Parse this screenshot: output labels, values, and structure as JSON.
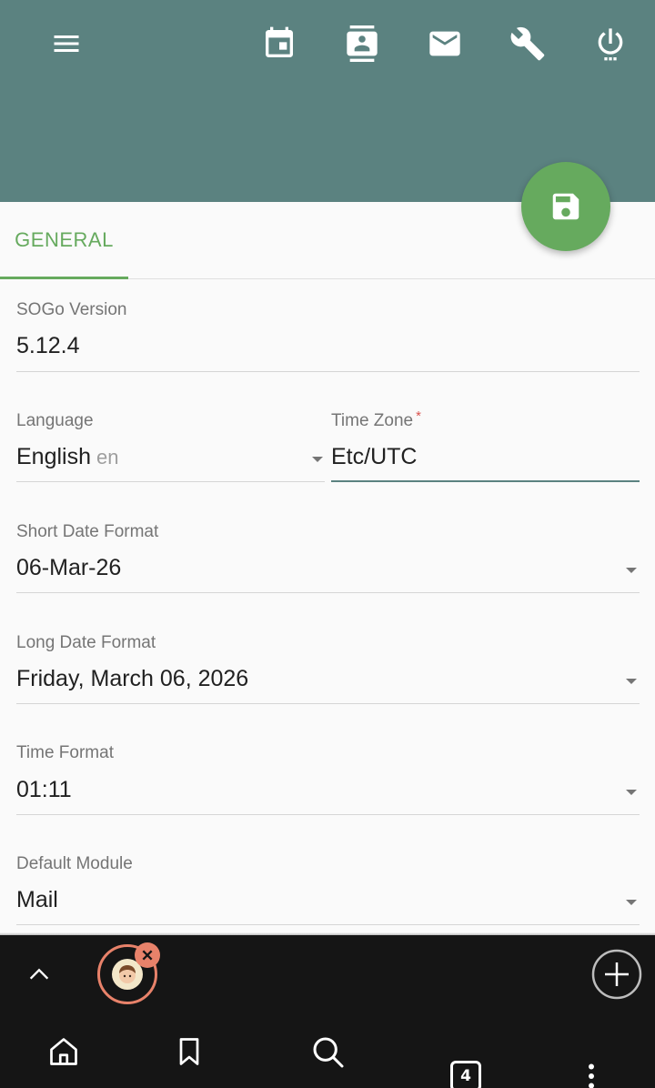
{
  "toolbar": {
    "menu_icon": "hamburger-menu-icon",
    "icons": [
      "calendar-icon",
      "contacts-icon",
      "mail-icon",
      "wrench-icon",
      "power-icon"
    ],
    "color": "#5b8280"
  },
  "fab": {
    "icon": "save-icon",
    "color": "#66aa5e"
  },
  "tabs": [
    {
      "label": "GENERAL",
      "active": true
    }
  ],
  "form": {
    "version": {
      "label": "SOGo Version",
      "value": "5.12.4"
    },
    "language": {
      "label": "Language",
      "value": "English",
      "code": "en"
    },
    "timezone": {
      "label": "Time Zone",
      "required_mark": "*",
      "value": "Etc/UTC"
    },
    "short_date": {
      "label": "Short Date Format",
      "value": "06-Mar-26"
    },
    "long_date": {
      "label": "Long Date Format",
      "value": "Friday, March 06, 2026"
    },
    "time_format": {
      "label": "Time Format",
      "value": "01:11"
    },
    "default_module": {
      "label": "Default Module",
      "value": "Mail"
    }
  },
  "browser": {
    "open_tabs": "4",
    "nav_icons": [
      "home-icon",
      "bookmark-icon",
      "search-icon",
      "tabs-counter-icon",
      "more-vert-icon"
    ],
    "accent": "#e8826a"
  }
}
